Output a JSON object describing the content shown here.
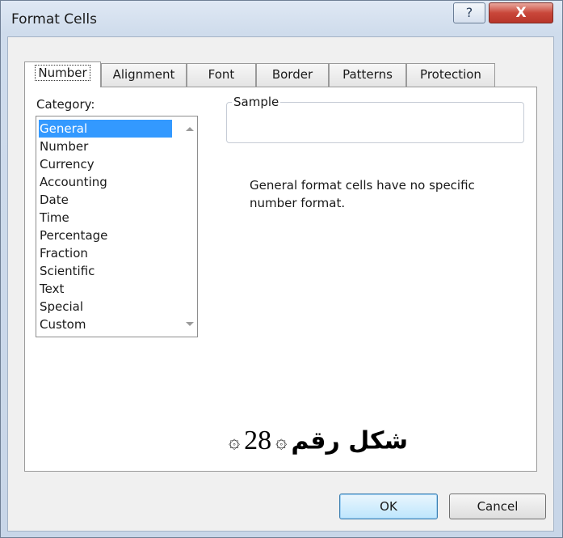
{
  "window": {
    "title": "Format Cells",
    "help_glyph": "?",
    "close_glyph": "X"
  },
  "tabs": [
    {
      "label": "Number",
      "active": true
    },
    {
      "label": "Alignment",
      "active": false
    },
    {
      "label": "Font",
      "active": false
    },
    {
      "label": "Border",
      "active": false
    },
    {
      "label": "Patterns",
      "active": false
    },
    {
      "label": "Protection",
      "active": false
    }
  ],
  "category": {
    "label": "Category:",
    "items": [
      "General",
      "Number",
      "Currency",
      "Accounting",
      "Date",
      "Time",
      "Percentage",
      "Fraction",
      "Scientific",
      "Text",
      "Special",
      "Custom"
    ],
    "selected": "General"
  },
  "sample": {
    "label": "Sample",
    "value": ""
  },
  "description": "General format cells have no specific number format.",
  "caption": {
    "word": "شكل رقم",
    "number": "28",
    "ornament_left": "۞",
    "ornament_right": "۞"
  },
  "buttons": {
    "ok": "OK",
    "cancel": "Cancel"
  },
  "colors": {
    "selection": "#3399ff",
    "close_button": "#c9473a"
  }
}
